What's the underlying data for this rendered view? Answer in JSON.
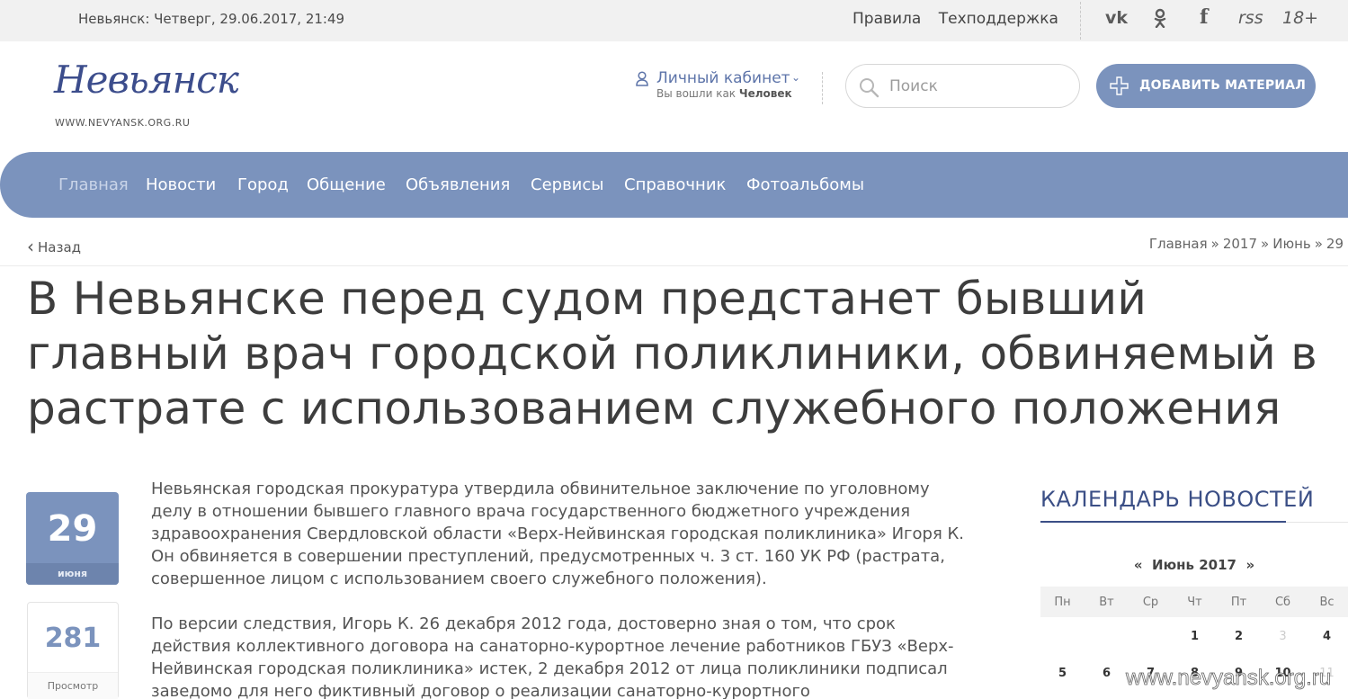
{
  "topbar": {
    "datetime": "Невьянск: Четверг, 29.06.2017, 21:49",
    "links": [
      "Правила",
      "Техподдержка"
    ],
    "social": {
      "vk": "vk",
      "ok": "ok",
      "fb": "f",
      "rss": "rss",
      "age": "18+"
    }
  },
  "header": {
    "logo": "Невьянск",
    "logo_url": "WWW.NEVYANSK.ORG.RU",
    "cabinet_label": "Личный кабинет",
    "logged_prefix": "Вы вошли как",
    "logged_user": "Человек",
    "search_placeholder": "Поиск",
    "add_button": "ДОБАВИТЬ МАТЕРИАЛ"
  },
  "nav": {
    "items": [
      "Главная",
      "Новости",
      "Город",
      "Общение",
      "Объявления",
      "Сервисы",
      "Справочник",
      "Фотоальбомы"
    ],
    "active": "Главная"
  },
  "breadcrumb": {
    "back": "Назад",
    "items": [
      "Главная",
      "2017",
      "Июнь",
      "29"
    ]
  },
  "article": {
    "title": "В Невьянске перед судом предстанет бывший главный врач городской поликлиники, обвиняемый в растрате с использованием служебного положения",
    "day": "29",
    "month": "июня",
    "views": "281",
    "views_label": "Просмотр",
    "paragraphs": [
      "Невьянская городская прокуратура утвердила обвинительное заключение по уголовному делу в отношении бывшего главного врача государственного бюджетного учреждения здравоохранения Свердловской области «Верх-Нейвинская городская поликлиника» Игоря К. Он обвиняется в совершении преступлений, предусмотренных ч. 3 ст. 160 УК РФ (растрата, совершенное лицом с использованием своего служебного положения).",
      "По версии следствия, Игорь К. 26 декабря 2012 года, достоверно зная о том, что срок действия коллективного договора на санаторно-курортное лечение работников ГБУЗ «Верх-Нейвинская городская поликлиника» истек, 2 декабря 2012 от лица поликлиники подписал заведомо для него фиктивный договор о реализации санаторно-курортного"
    ]
  },
  "calendar": {
    "title": "КАЛЕНДАРЬ НОВОСТЕЙ",
    "prev": "«",
    "month": "Июнь 2017",
    "next": "»",
    "weekdays": [
      "Пн",
      "Вт",
      "Ср",
      "Чт",
      "Пт",
      "Сб",
      "Вс"
    ],
    "week1": [
      "1",
      "2",
      "3",
      "4"
    ],
    "week2": [
      "5",
      "6",
      "7",
      "8",
      "9",
      "10",
      "11"
    ]
  },
  "watermark": "www.nevyansk.org.ru"
}
